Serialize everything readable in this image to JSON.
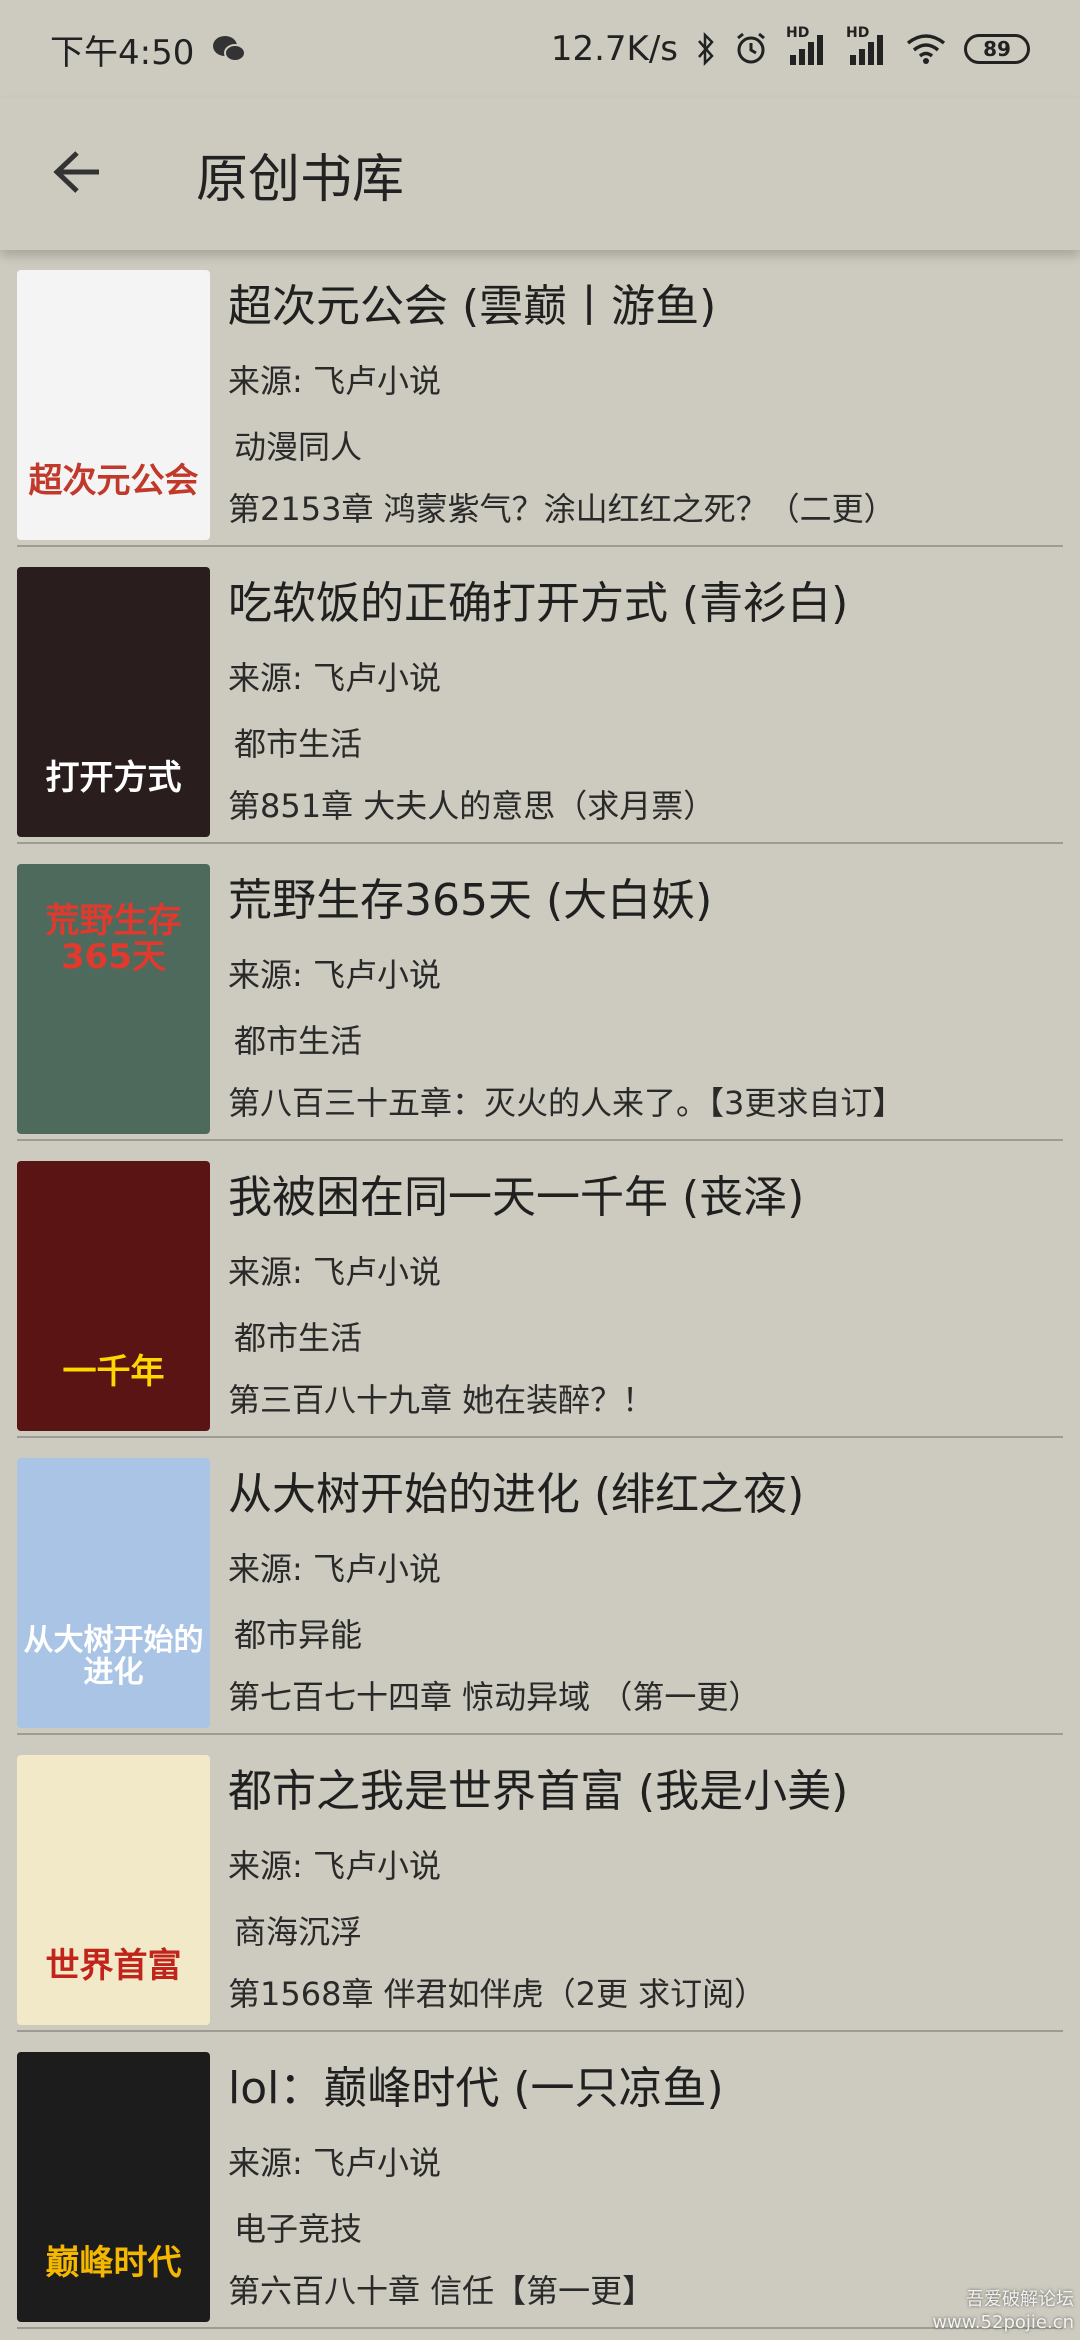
{
  "status_bar": {
    "time": "下午4:50",
    "network_speed": "12.7K/s",
    "signal_1_label": "HD",
    "signal_2_label": "HD",
    "battery": "89"
  },
  "app_bar": {
    "title": "原创书库"
  },
  "books": [
    {
      "title": "超次元公会 (雲巅丨游鱼)",
      "source": "来源: 飞卢小说",
      "genre": "动漫同人",
      "chapter": "第2153章 鸿蒙紫气？涂山红红之死？（二更）",
      "cover_text": "超次元公会",
      "cover_bg": "#f4f4f4",
      "cover_fg": "#c0392b"
    },
    {
      "title": "吃软饭的正确打开方式 (青衫白)",
      "source": "来源: 飞卢小说",
      "genre": "都市生活",
      "chapter": "第851章 大夫人的意思（求月票）",
      "cover_text": "打开方式",
      "cover_bg": "#2a1d1d",
      "cover_fg": "#ffffff"
    },
    {
      "title": "荒野生存365天 (大白妖)",
      "source": "来源: 飞卢小说",
      "genre": "都市生活",
      "chapter": "第八百三十五章：灭火的人来了。【3更求自订】",
      "cover_text": "荒野生存365天",
      "cover_bg": "#4e6a5c",
      "cover_fg": "#e03a2e"
    },
    {
      "title": "我被困在同一天一千年 (丧泽)",
      "source": "来源: 飞卢小说",
      "genre": "都市生活",
      "chapter": "第三百八十九章 她在装醉？！",
      "cover_text": "一千年",
      "cover_bg": "#5a1414",
      "cover_fg": "#ffd700"
    },
    {
      "title": "从大树开始的进化 (绯红之夜)",
      "source": "来源: 飞卢小说",
      "genre": "都市异能",
      "chapter": "第七百七十四章 惊动异域 （第一更）",
      "cover_text": "从大树开始的进化",
      "cover_bg": "#a9c4e4",
      "cover_fg": "#ffffff"
    },
    {
      "title": "都市之我是世界首富 (我是小美)",
      "source": "来源: 飞卢小说",
      "genre": "商海沉浮",
      "chapter": "第1568章 伴君如伴虎（2更 求订阅）",
      "cover_text": "世界首富",
      "cover_bg": "#f2e9c9",
      "cover_fg": "#c0241a"
    },
    {
      "title": "lol：巅峰时代 (一只凉鱼)",
      "source": "来源: 飞卢小说",
      "genre": "电子竞技",
      "chapter": "第六百八十章 信任【第一更】",
      "cover_text": "巅峰时代",
      "cover_bg": "#1c1c1c",
      "cover_fg": "#f5b800"
    }
  ],
  "watermark": {
    "line1": "吾爱破解论坛",
    "line2": "www.52pojie.cn"
  }
}
